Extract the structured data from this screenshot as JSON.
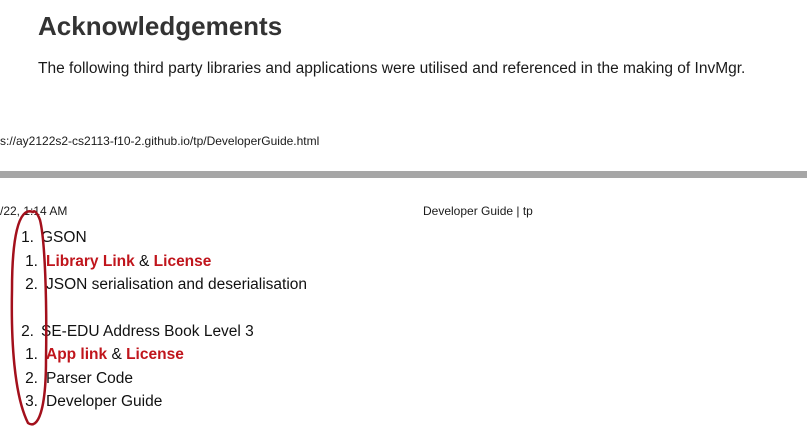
{
  "heading": "Acknowledgements",
  "intro": "The following third party libraries and applications were utilised and referenced in the making of InvMgr.",
  "print_footer": {
    "url": "s://ay2122s2-cs2113-f10-2.github.io/tp/DeveloperGuide.html"
  },
  "print_header": {
    "date": "/22, 1:14 AM",
    "title": "Developer Guide | tp"
  },
  "list": [
    {
      "number": "1.",
      "label": "GSON",
      "subitems": [
        {
          "number": "1.",
          "link1": "Library Link",
          "sep": " & ",
          "link2": "License"
        },
        {
          "number": "2.",
          "text": "JSON serialisation and deserialisation"
        }
      ]
    },
    {
      "number": "2.",
      "label": "SE-EDU Address Book Level 3",
      "subitems": [
        {
          "number": "1.",
          "link1": "App link",
          "sep": " & ",
          "link2": "License"
        },
        {
          "number": "2.",
          "text": "Parser Code"
        },
        {
          "number": "3.",
          "text": "Developer Guide"
        }
      ]
    }
  ],
  "colors": {
    "link": "#c0151c",
    "annotation": "#a3101c",
    "divider": "#a6a6a6"
  }
}
